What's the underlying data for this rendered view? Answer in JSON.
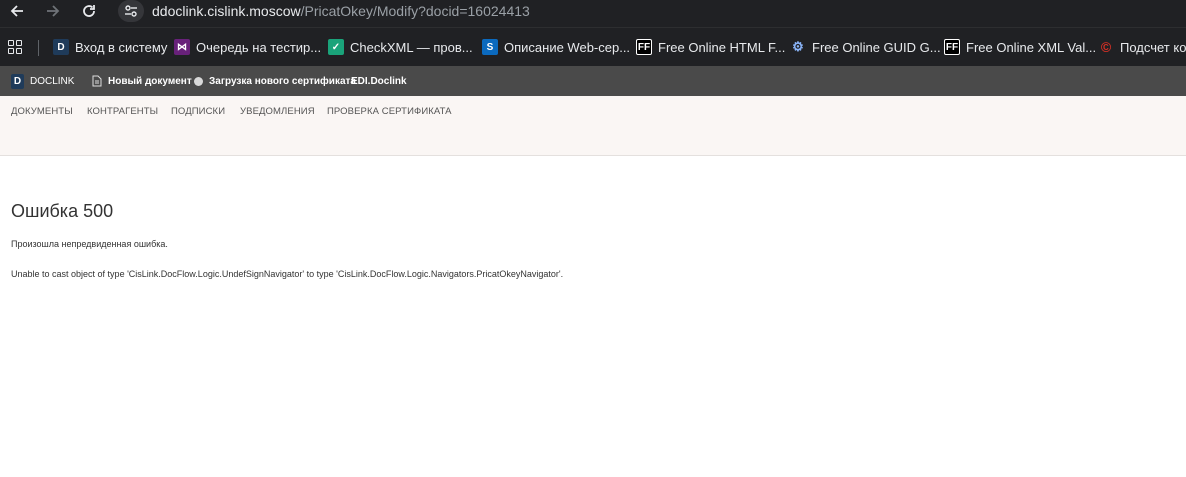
{
  "browser": {
    "url_host": "ddoclink.cislink.moscow",
    "url_path": "/PricatOkey/Modify?docid=16024413"
  },
  "bookmarks": [
    {
      "label": "Вход в систему",
      "icon": "doclink-d-icon",
      "color": "#1f3b5a"
    },
    {
      "label": "Очередь на тестир...",
      "icon": "visual-studio-icon",
      "color": "#68217a"
    },
    {
      "label": "CheckXML — пров...",
      "icon": "checkxml-icon",
      "color": "#1aa37a"
    },
    {
      "label": "Описание Web-сер...",
      "icon": "sharepoint-icon",
      "color": "#0b6abf"
    },
    {
      "label": "Free Online HTML F...",
      "icon": "ff-icon",
      "color": "#000000"
    },
    {
      "label": "Free Online GUID G...",
      "icon": "gears-icon",
      "color": "#202124"
    },
    {
      "label": "Free Online XML Val...",
      "icon": "ff-icon",
      "color": "#000000"
    },
    {
      "label": "Подсчет кол",
      "icon": "copyright-icon",
      "color": "#d93025"
    }
  ],
  "app_header": {
    "logo_label": "DOCLINK",
    "new_doc": "Новый документ",
    "upload_cert": "Загрузка нового сертификата",
    "edi": "EDI.Doclink"
  },
  "menu": [
    "ДОКУМЕНТЫ",
    "КОНТРАГЕНТЫ",
    "ПОДПИСКИ",
    "УВЕДОМЛЕНИЯ",
    "ПРОВЕРКА СЕРТИФИКАТА"
  ],
  "error": {
    "title": "Ошибка 500",
    "message": "Произошла непредвиденная ошибка.",
    "detail": "Unable to cast object of type 'CisLink.DocFlow.Logic.UndefSignNavigator' to type 'CisLink.DocFlow.Logic.Navigators.PricatOkeyNavigator'."
  }
}
